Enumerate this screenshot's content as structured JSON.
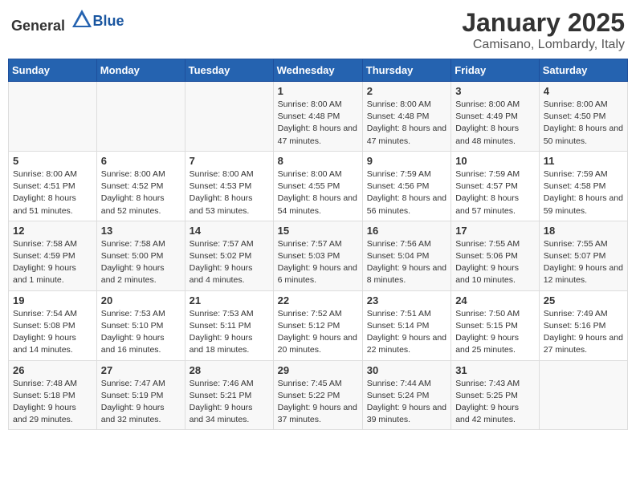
{
  "header": {
    "logo_general": "General",
    "logo_blue": "Blue",
    "month": "January 2025",
    "location": "Camisano, Lombardy, Italy"
  },
  "weekdays": [
    "Sunday",
    "Monday",
    "Tuesday",
    "Wednesday",
    "Thursday",
    "Friday",
    "Saturday"
  ],
  "weeks": [
    [
      {
        "day": "",
        "info": ""
      },
      {
        "day": "",
        "info": ""
      },
      {
        "day": "",
        "info": ""
      },
      {
        "day": "1",
        "info": "Sunrise: 8:00 AM\nSunset: 4:48 PM\nDaylight: 8 hours and 47 minutes."
      },
      {
        "day": "2",
        "info": "Sunrise: 8:00 AM\nSunset: 4:48 PM\nDaylight: 8 hours and 47 minutes."
      },
      {
        "day": "3",
        "info": "Sunrise: 8:00 AM\nSunset: 4:49 PM\nDaylight: 8 hours and 48 minutes."
      },
      {
        "day": "4",
        "info": "Sunrise: 8:00 AM\nSunset: 4:50 PM\nDaylight: 8 hours and 50 minutes."
      }
    ],
    [
      {
        "day": "5",
        "info": "Sunrise: 8:00 AM\nSunset: 4:51 PM\nDaylight: 8 hours and 51 minutes."
      },
      {
        "day": "6",
        "info": "Sunrise: 8:00 AM\nSunset: 4:52 PM\nDaylight: 8 hours and 52 minutes."
      },
      {
        "day": "7",
        "info": "Sunrise: 8:00 AM\nSunset: 4:53 PM\nDaylight: 8 hours and 53 minutes."
      },
      {
        "day": "8",
        "info": "Sunrise: 8:00 AM\nSunset: 4:55 PM\nDaylight: 8 hours and 54 minutes."
      },
      {
        "day": "9",
        "info": "Sunrise: 7:59 AM\nSunset: 4:56 PM\nDaylight: 8 hours and 56 minutes."
      },
      {
        "day": "10",
        "info": "Sunrise: 7:59 AM\nSunset: 4:57 PM\nDaylight: 8 hours and 57 minutes."
      },
      {
        "day": "11",
        "info": "Sunrise: 7:59 AM\nSunset: 4:58 PM\nDaylight: 8 hours and 59 minutes."
      }
    ],
    [
      {
        "day": "12",
        "info": "Sunrise: 7:58 AM\nSunset: 4:59 PM\nDaylight: 9 hours and 1 minute."
      },
      {
        "day": "13",
        "info": "Sunrise: 7:58 AM\nSunset: 5:00 PM\nDaylight: 9 hours and 2 minutes."
      },
      {
        "day": "14",
        "info": "Sunrise: 7:57 AM\nSunset: 5:02 PM\nDaylight: 9 hours and 4 minutes."
      },
      {
        "day": "15",
        "info": "Sunrise: 7:57 AM\nSunset: 5:03 PM\nDaylight: 9 hours and 6 minutes."
      },
      {
        "day": "16",
        "info": "Sunrise: 7:56 AM\nSunset: 5:04 PM\nDaylight: 9 hours and 8 minutes."
      },
      {
        "day": "17",
        "info": "Sunrise: 7:55 AM\nSunset: 5:06 PM\nDaylight: 9 hours and 10 minutes."
      },
      {
        "day": "18",
        "info": "Sunrise: 7:55 AM\nSunset: 5:07 PM\nDaylight: 9 hours and 12 minutes."
      }
    ],
    [
      {
        "day": "19",
        "info": "Sunrise: 7:54 AM\nSunset: 5:08 PM\nDaylight: 9 hours and 14 minutes."
      },
      {
        "day": "20",
        "info": "Sunrise: 7:53 AM\nSunset: 5:10 PM\nDaylight: 9 hours and 16 minutes."
      },
      {
        "day": "21",
        "info": "Sunrise: 7:53 AM\nSunset: 5:11 PM\nDaylight: 9 hours and 18 minutes."
      },
      {
        "day": "22",
        "info": "Sunrise: 7:52 AM\nSunset: 5:12 PM\nDaylight: 9 hours and 20 minutes."
      },
      {
        "day": "23",
        "info": "Sunrise: 7:51 AM\nSunset: 5:14 PM\nDaylight: 9 hours and 22 minutes."
      },
      {
        "day": "24",
        "info": "Sunrise: 7:50 AM\nSunset: 5:15 PM\nDaylight: 9 hours and 25 minutes."
      },
      {
        "day": "25",
        "info": "Sunrise: 7:49 AM\nSunset: 5:16 PM\nDaylight: 9 hours and 27 minutes."
      }
    ],
    [
      {
        "day": "26",
        "info": "Sunrise: 7:48 AM\nSunset: 5:18 PM\nDaylight: 9 hours and 29 minutes."
      },
      {
        "day": "27",
        "info": "Sunrise: 7:47 AM\nSunset: 5:19 PM\nDaylight: 9 hours and 32 minutes."
      },
      {
        "day": "28",
        "info": "Sunrise: 7:46 AM\nSunset: 5:21 PM\nDaylight: 9 hours and 34 minutes."
      },
      {
        "day": "29",
        "info": "Sunrise: 7:45 AM\nSunset: 5:22 PM\nDaylight: 9 hours and 37 minutes."
      },
      {
        "day": "30",
        "info": "Sunrise: 7:44 AM\nSunset: 5:24 PM\nDaylight: 9 hours and 39 minutes."
      },
      {
        "day": "31",
        "info": "Sunrise: 7:43 AM\nSunset: 5:25 PM\nDaylight: 9 hours and 42 minutes."
      },
      {
        "day": "",
        "info": ""
      }
    ]
  ]
}
